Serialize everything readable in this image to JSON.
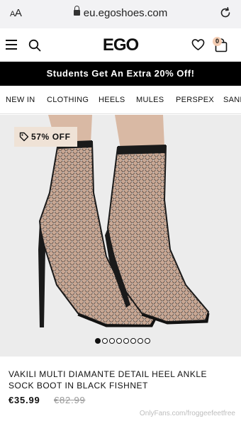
{
  "browser": {
    "aa_label_big": "A",
    "aa_label_small": "A",
    "url": "eu.egoshoes.com"
  },
  "header": {
    "logo": "EGO",
    "bag_count": "0"
  },
  "promo": {
    "text": "Students Get An Extra 20% Off!"
  },
  "categories": [
    "NEW IN",
    "CLOTHING",
    "HEELS",
    "MULES",
    "PERSPEX",
    "SAND"
  ],
  "product": {
    "discount": "57% OFF",
    "title": "VAKILI MULTI DIAMANTE DETAIL HEEL ANKLE SOCK BOOT IN BLACK FISHNET",
    "price": "€35.99",
    "old_price": "€82.99",
    "carousel_count": 8,
    "carousel_active_index": 0
  },
  "watermark": "OnlyFans.com/froggeefeetfree",
  "colors": {
    "promo_bg": "#000000",
    "discount_bg": "#efe2d6",
    "image_bg": "#ececec"
  },
  "icons": [
    "lock-icon",
    "reload-icon",
    "menu-icon",
    "search-icon",
    "heart-icon",
    "bag-icon",
    "tag-icon"
  ]
}
